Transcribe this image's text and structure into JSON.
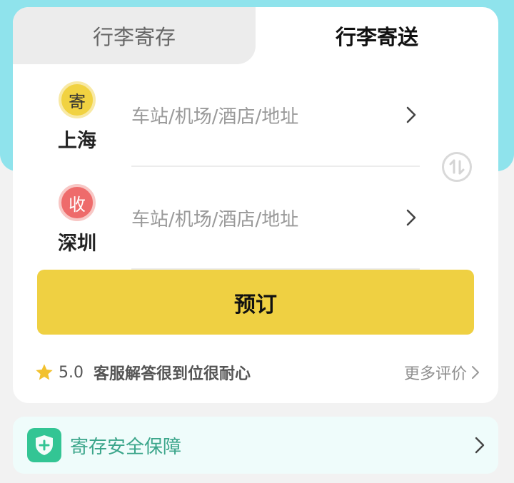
{
  "tabs": {
    "storage": "行李寄存",
    "delivery": "行李寄送"
  },
  "route": {
    "sender": {
      "badge": "寄",
      "city": "上海",
      "placeholder": "车站/机场/酒店/地址"
    },
    "receiver": {
      "badge": "收",
      "city": "深圳",
      "placeholder": "车站/机场/酒店/地址"
    }
  },
  "book_button": "预订",
  "review": {
    "score": "5.0",
    "text": "客服解答很到位很耐心",
    "more": "更多评价"
  },
  "safety": {
    "label": "寄存安全保障"
  },
  "colors": {
    "band": "#8fe3ec",
    "accent_yellow": "#efd042",
    "receiver_red": "#ee6b6b",
    "safety_green": "#33c594"
  },
  "icons": [
    "chevron-right-icon",
    "swap-icon",
    "star-icon",
    "shield-plus-icon"
  ]
}
